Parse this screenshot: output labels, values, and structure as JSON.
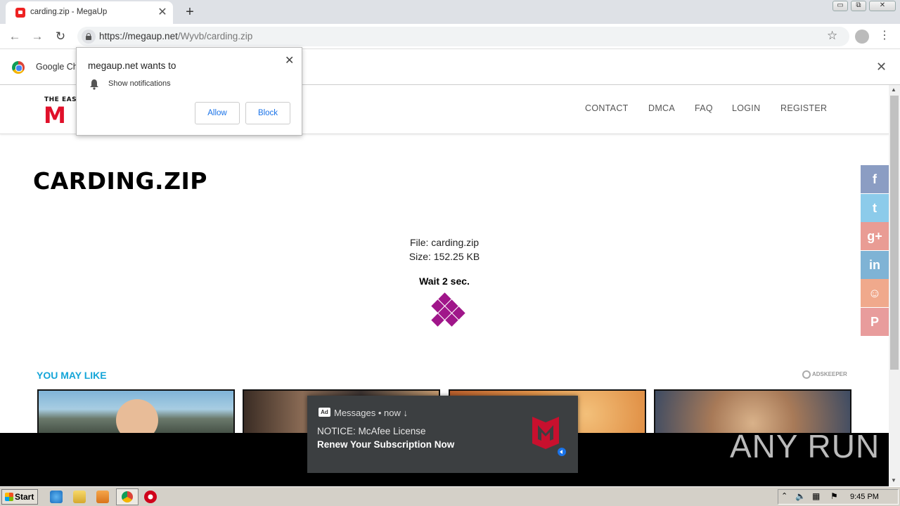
{
  "browser": {
    "tab_title": "carding.zip - MegaUp",
    "tab_close": "✕",
    "new_tab": "+",
    "url_host": "https://megaup.net",
    "url_path": "/Wyvb/carding.zip",
    "infobar_text": "Google Ch",
    "win_minimize": "▭",
    "win_restore": "⧉",
    "win_close": "✕"
  },
  "permission_popup": {
    "title": "megaup.net wants to",
    "item": "Show notifications",
    "allow": "Allow",
    "block": "Block",
    "close": "✕"
  },
  "site": {
    "logo_small": "THE EAS",
    "logo_big": "M",
    "nav": [
      "CONTACT",
      "DMCA",
      "FAQ",
      "LOGIN",
      "REGISTER"
    ]
  },
  "file": {
    "title": "CARDING.ZIP",
    "name_line": "File: carding.zip",
    "size_line": "Size: 152.25 KB",
    "wait": "Wait 2 sec."
  },
  "recommend": {
    "title": "YOU MAY LIKE",
    "provider": "ADSKEEPER"
  },
  "social": [
    {
      "name": "facebook-icon",
      "glyph": "f",
      "color": "#8b9dc3"
    },
    {
      "name": "twitter-icon",
      "glyph": "t",
      "color": "#8ccbea"
    },
    {
      "name": "google-plus-icon",
      "glyph": "g+",
      "color": "#e99c94"
    },
    {
      "name": "linkedin-icon",
      "glyph": "in",
      "color": "#7fb3d5"
    },
    {
      "name": "reddit-icon",
      "glyph": "☺",
      "color": "#f0a98c"
    },
    {
      "name": "pinterest-icon",
      "glyph": "P",
      "color": "#e89c9c"
    }
  ],
  "toast": {
    "ad_label": "Ad",
    "source": "Messages • now ↓",
    "line1": "NOTICE: McAfee License",
    "line2": "Renew Your Subscription Now"
  },
  "watermark": "ANY RUN",
  "taskbar": {
    "start": "Start",
    "clock": "9:45 PM"
  }
}
